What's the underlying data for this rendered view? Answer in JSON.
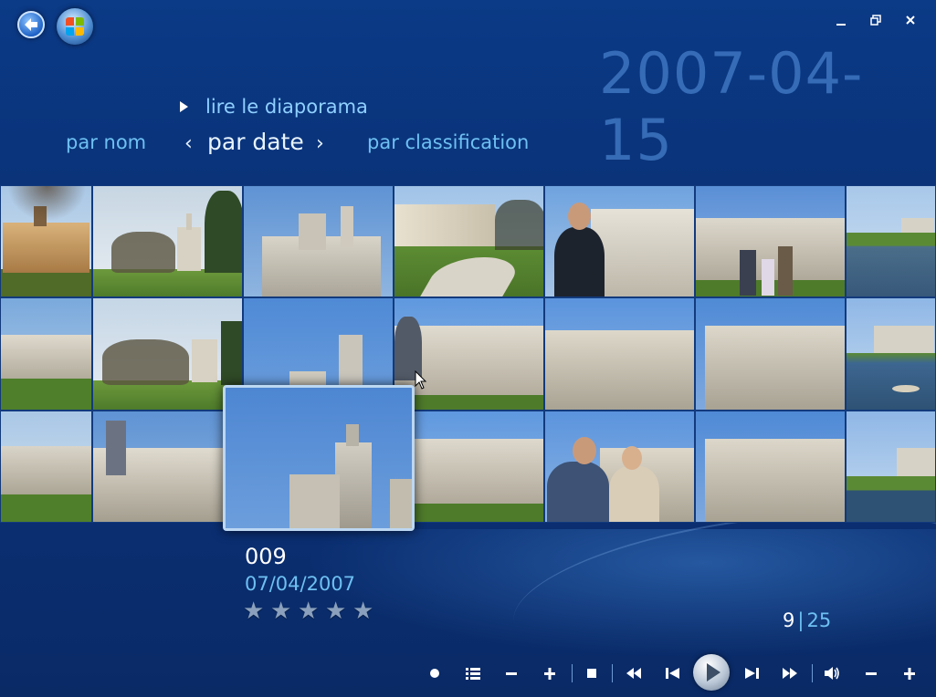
{
  "window": {
    "date_heading": "2007-04-15"
  },
  "menu": {
    "slideshow_label": "lire le diaporama",
    "sort_options": [
      {
        "label": "par nom",
        "active": false
      },
      {
        "label": "par date",
        "active": true
      },
      {
        "label": "par classification",
        "active": false
      }
    ]
  },
  "selected": {
    "name": "009",
    "date": "07/04/2007",
    "rating_max": 5,
    "rating": 0
  },
  "pager": {
    "current": "9",
    "separator": "|",
    "total": "25"
  },
  "icons": {
    "back": "back-arrow-icon",
    "start": "windows-logo-icon",
    "minimize": "minimize-icon",
    "restore": "restore-icon",
    "close": "close-icon",
    "transport": [
      "record-dot-icon",
      "list-icon",
      "minus-icon",
      "plus-icon",
      "stop-icon",
      "rewind-icon",
      "skip-back-icon",
      "play-icon",
      "skip-forward-icon",
      "fast-forward-icon",
      "volume-icon",
      "volume-down-icon",
      "volume-up-icon"
    ]
  },
  "colors": {
    "accent": "#6ec0f2",
    "active_text": "#e8f4ff",
    "background": "#0a3278",
    "date_heading": "#467dc8"
  }
}
